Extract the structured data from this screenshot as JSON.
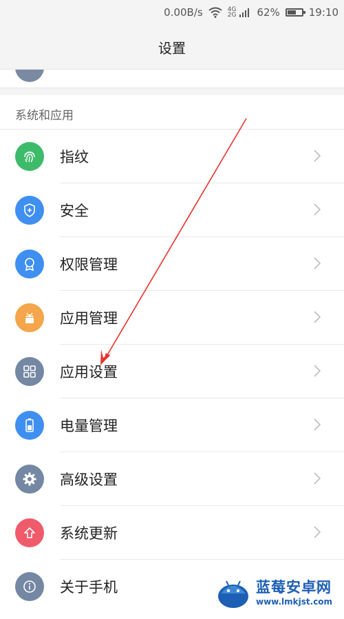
{
  "status_bar": {
    "speed": "0.00B/s",
    "net_top": "4G",
    "net_bottom": "2G",
    "battery_text": "62%",
    "battery_level": 0.62,
    "time": "19:10"
  },
  "header": {
    "title": "设置"
  },
  "section": {
    "title": "系统和应用",
    "items": [
      {
        "label": "指纹",
        "icon": "fingerprint-icon",
        "color": "#3dbb6b"
      },
      {
        "label": "安全",
        "icon": "shield-icon",
        "color": "#3f8ff0"
      },
      {
        "label": "权限管理",
        "icon": "permission-icon",
        "color": "#3f8ff0"
      },
      {
        "label": "应用管理",
        "icon": "android-icon",
        "color": "#f5a54a"
      },
      {
        "label": "应用设置",
        "icon": "grid-icon",
        "color": "#7487a3"
      },
      {
        "label": "电量管理",
        "icon": "battery-icon",
        "color": "#3f8ff0"
      },
      {
        "label": "高级设置",
        "icon": "gear-icon",
        "color": "#7487a3"
      },
      {
        "label": "系统更新",
        "icon": "upload-icon",
        "color": "#ef5b6a"
      },
      {
        "label": "关于手机",
        "icon": "info-icon",
        "color": "#7487a3"
      }
    ]
  },
  "watermark": {
    "title": "蓝莓安卓网",
    "url": "www.lmkjst.com"
  },
  "colors": {
    "annotation_arrow": "#e8312b",
    "background": "#f4f4f4"
  }
}
